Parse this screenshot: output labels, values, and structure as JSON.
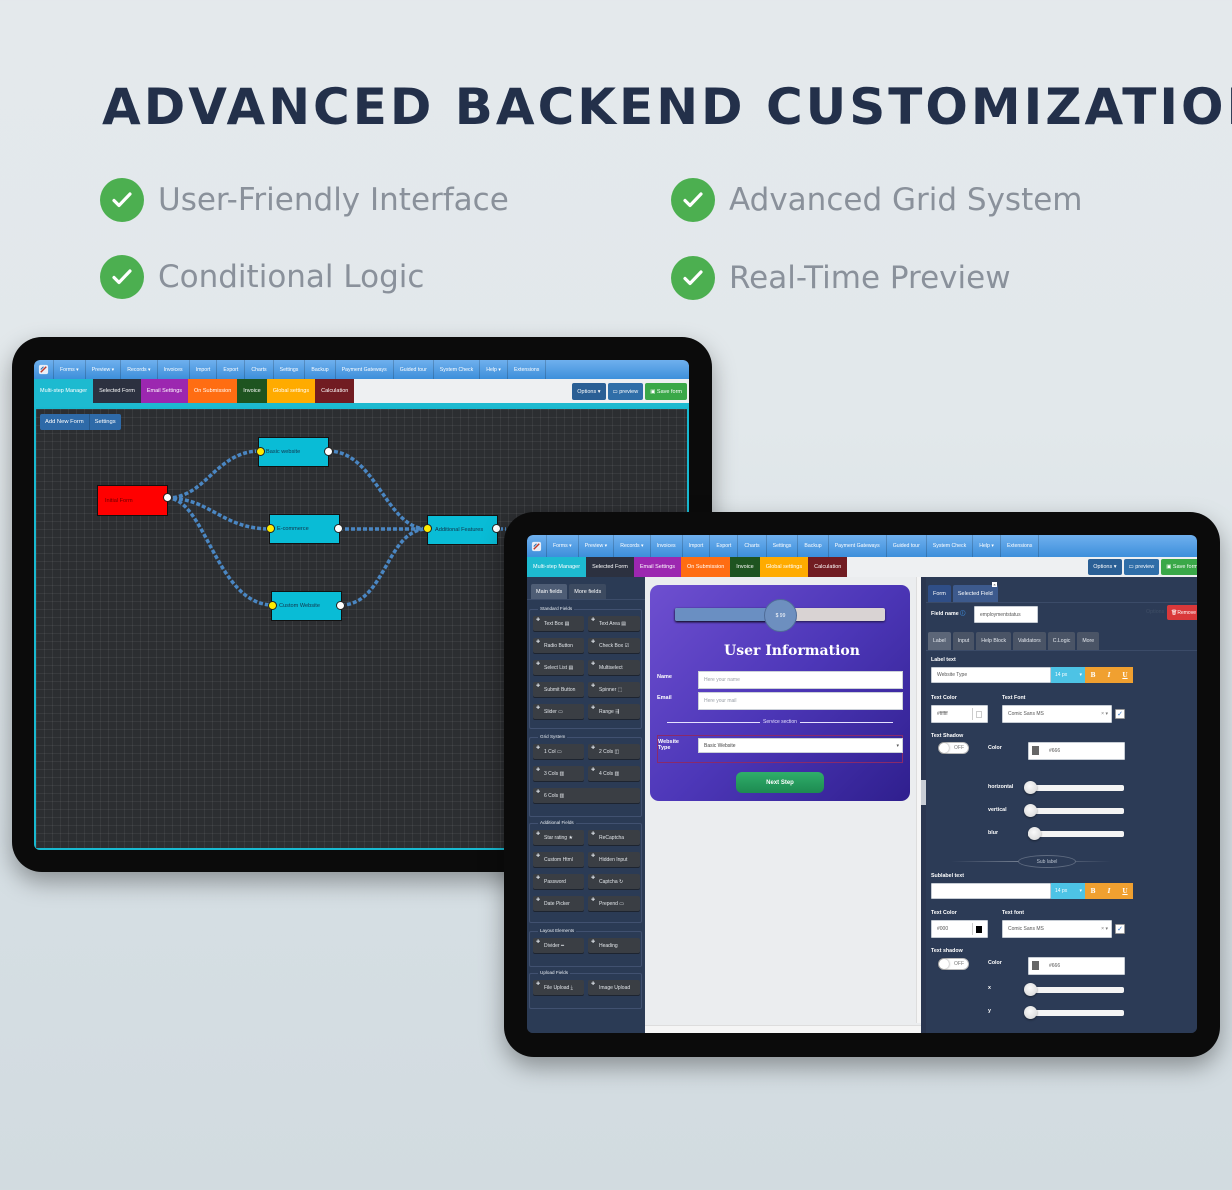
{
  "hero": {
    "title": "ADVANCED BACKEND CUSTOMIZATION",
    "features": [
      {
        "label": "User-Friendly Interface",
        "icon": "check-circle-icon"
      },
      {
        "label": "Advanced Grid System",
        "icon": "check-circle-icon"
      },
      {
        "label": "Conditional Logic",
        "icon": "check-circle-icon"
      },
      {
        "label": "Real-Time Preview",
        "icon": "check-circle-icon"
      }
    ],
    "accent": "#4caf50"
  },
  "topnav": {
    "items": [
      "Forms ▾",
      "Preview ▾",
      "Records ▾",
      "Invoices",
      "Import",
      "Export",
      "Charts",
      "Settings",
      "Backup",
      "Payment Gateways",
      "Guided tour",
      "System Check",
      "Help ▾",
      "Extensions"
    ],
    "icons": [
      "file-icon",
      "monitor-icon",
      "info-icon",
      "card-icon",
      "undo-icon",
      "share-icon",
      "chart-icon",
      "gear-icon",
      "cloud-icon",
      "card-icon",
      "question-icon",
      "gear-icon",
      "life-ring-icon",
      "plug-icon"
    ]
  },
  "subnav": {
    "tabs": [
      {
        "label": "Multi-step Manager",
        "color": "#1dbad0"
      },
      {
        "label": "Selected Form",
        "color": "#2c3140"
      },
      {
        "label": "Email Settings",
        "color": "#9c27b0"
      },
      {
        "label": "On Submission",
        "color": "#ff6d12"
      },
      {
        "label": "Invoice",
        "color": "#1e5420"
      },
      {
        "label": "Global settings",
        "color": "#ffab00"
      },
      {
        "label": "Calculation",
        "color": "#711c22"
      }
    ],
    "options_label": "Options ▾",
    "preview_label": "preview",
    "save_label": "Save form"
  },
  "multistep": {
    "add_new_form": "Add New Form",
    "settings": "Settings",
    "nodes": [
      {
        "id": "initial",
        "label": "Initial Form"
      },
      {
        "id": "basic",
        "label": "Basic website"
      },
      {
        "id": "ecommerce",
        "label": "E-commerce"
      },
      {
        "id": "custom",
        "label": "Custom Website"
      },
      {
        "id": "additional",
        "label": "Additional Features"
      }
    ]
  },
  "fields_panel": {
    "tabs": [
      "Main fields",
      "More fields"
    ],
    "groups": [
      {
        "title": "Standard Fields",
        "items": [
          "Text Box ▤",
          "Text Area ▤",
          "Radio Button",
          "Check Box ☑",
          "Select List ▤",
          "Multiselect",
          "Submit Button",
          "Spinner ⬚",
          "Slider ▭",
          "Range ⇶"
        ]
      },
      {
        "title": "Grid System",
        "items": [
          "1 Col ▭",
          "2 Cols ◫",
          "3 Cols ▥",
          "4 Cols ▥",
          "6 Cols ▥"
        ]
      },
      {
        "title": "Additional Fields",
        "items": [
          "Star rating ★",
          "ReCaptcha",
          "Custom Html",
          "Hidden Input",
          "Password",
          "Captcha ↻",
          "Date Picker",
          "Prepend ▭"
        ]
      },
      {
        "title": "Layout Elements",
        "items": [
          "Divider ━",
          "Heading"
        ]
      },
      {
        "title": "Upload Fields",
        "items": [
          "File Upload ⤓",
          "Image Upload"
        ]
      }
    ]
  },
  "form_preview": {
    "price": "$ 99",
    "price_fraction": 0.5,
    "title": "User Information",
    "name_label": "Name",
    "name_placeholder": "Here your name",
    "email_label": "Email",
    "email_placeholder": "Here your mail",
    "section_label": "Service section",
    "website_type_label": "Website Type",
    "website_type_value": "Basic Website",
    "next_label": "Next Step"
  },
  "properties": {
    "tabs": [
      "Form",
      "Selected Field"
    ],
    "field_name_label": "Field name",
    "field_name_value": "employmentstatus",
    "options_label": "Options",
    "remove_label": "Remove",
    "sub_tabs": [
      "Label",
      "Input",
      "Help Block",
      "Validators",
      "C.Logic",
      "More"
    ],
    "label_text_label": "Label text",
    "label_text_value": "Website Type",
    "font_size": "14 px",
    "bold": "B",
    "italic": "I",
    "underline": "U",
    "text_color_label": "Text Color",
    "text_color_value": "#ffffff",
    "text_font_label": "Text Font",
    "text_font_value": "Comic Sans MS",
    "text_shadow_label": "Text Shadow",
    "toggle_off": "OFF",
    "color_label": "Color",
    "shadow_color": "#666",
    "horizontal_label": "horizontal",
    "vertical_label": "vertical",
    "blur_label": "blur",
    "horizontal_value": 0,
    "vertical_value": 0,
    "blur_value": 0.05,
    "sub_label_divider": "Sub label",
    "sublabel_text_label": "Sublabel text",
    "sublabel_text_value": "",
    "sub_font_size": "14 px",
    "sub_text_color_label": "Text Color",
    "sub_text_color_value": "#000",
    "sub_text_font_label": "Text font",
    "sub_text_font_value": "Comic Sans MS",
    "sub_text_shadow_label": "Text shadow",
    "sub_shadow_color": "#666",
    "x_label": "x",
    "y_label": "y"
  }
}
